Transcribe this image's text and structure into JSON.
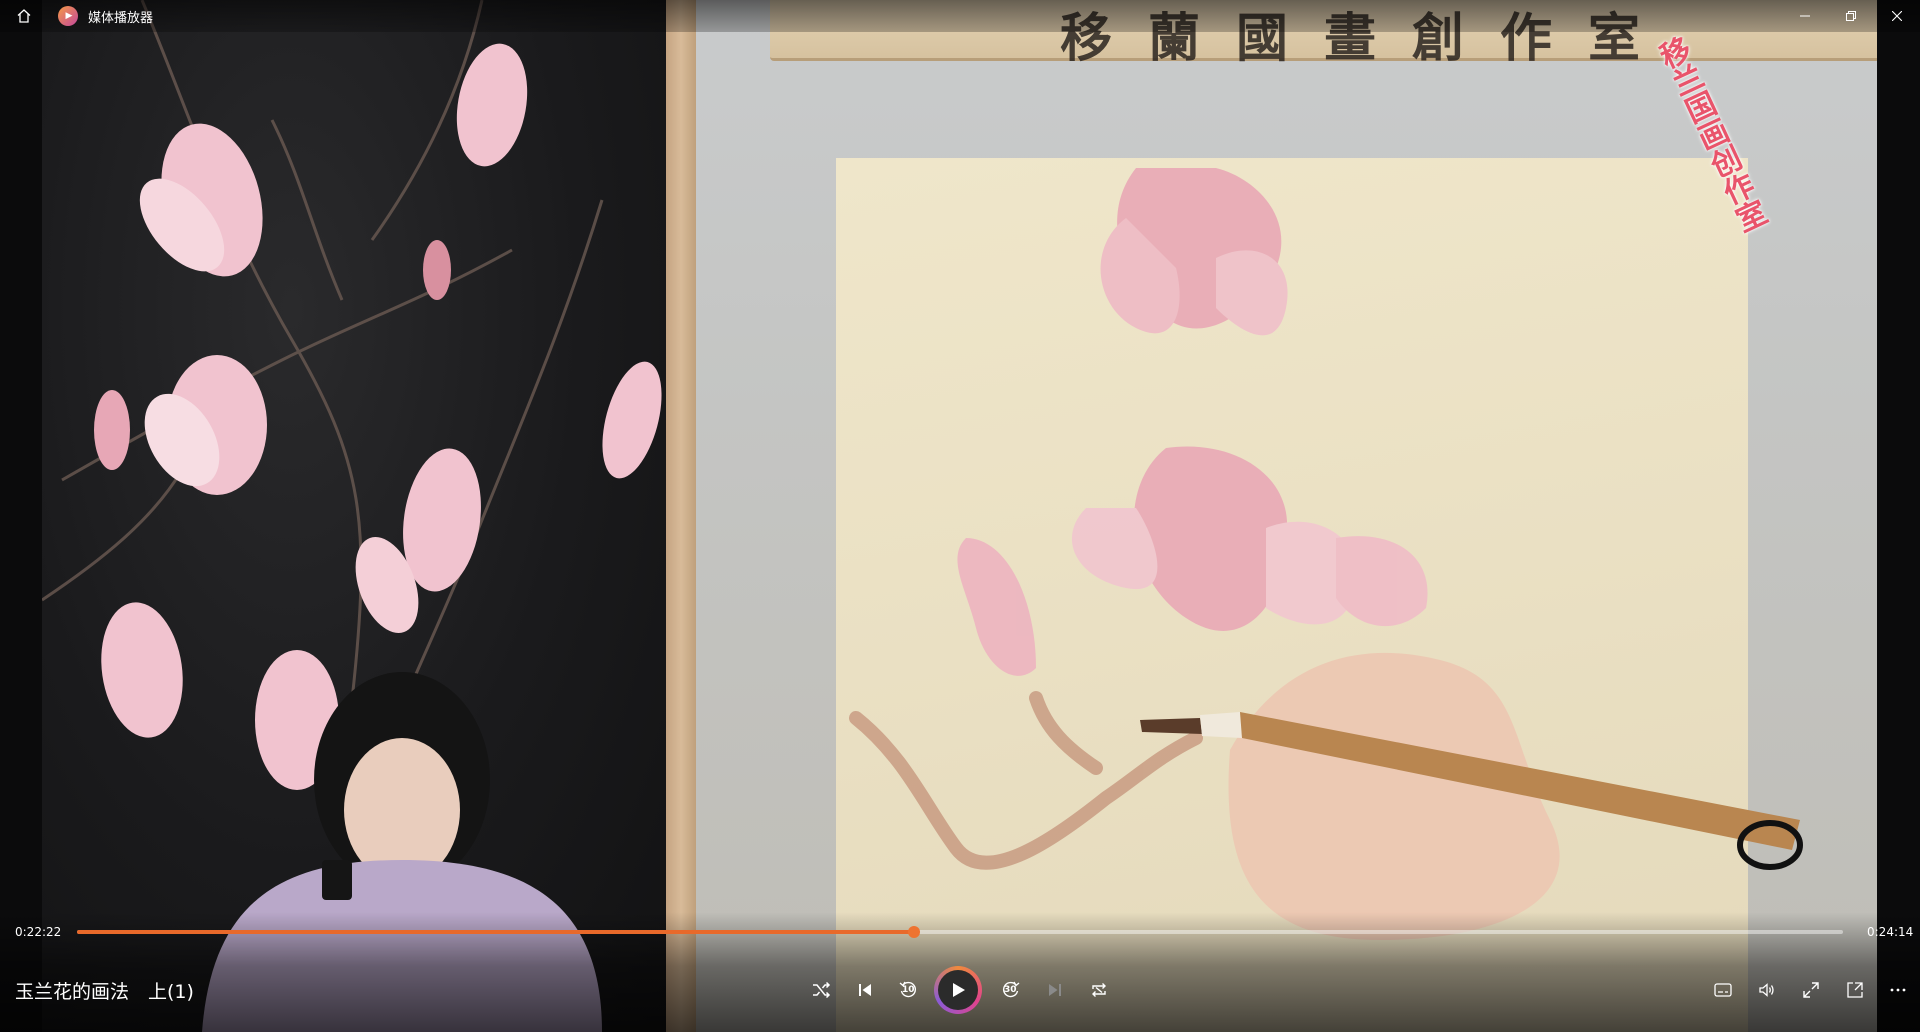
{
  "window": {
    "title": "媒体播放器",
    "icons": {
      "home": "home-icon",
      "logo": "media-player-logo",
      "minimize": "minimize-icon",
      "restore": "restore-icon",
      "close": "close-icon"
    }
  },
  "video": {
    "plaque_text": "移蘭國畫創作室",
    "watermark_text": "移兰国画创作室"
  },
  "playback": {
    "current_time": "0:22:22",
    "total_time": "0:24:14",
    "progress": 0.4739
  },
  "media": {
    "title": "玉兰花的画法　上(1)"
  },
  "controls": {
    "shuffle": "shuffle-icon",
    "previous": "previous-icon",
    "skip_back": "10",
    "play": "play-icon",
    "skip_forward": "30",
    "next": "next-icon",
    "repeat": "repeat-icon",
    "subtitles": "subtitles-icon",
    "volume": "volume-icon",
    "fullscreen": "fullscreen-icon",
    "mini_view": "mini-view-icon",
    "more": "more-icon"
  },
  "colors": {
    "accent": "#E8692A",
    "play_ring": [
      "#F08A3C",
      "#E0438D",
      "#8B5BD6"
    ]
  }
}
